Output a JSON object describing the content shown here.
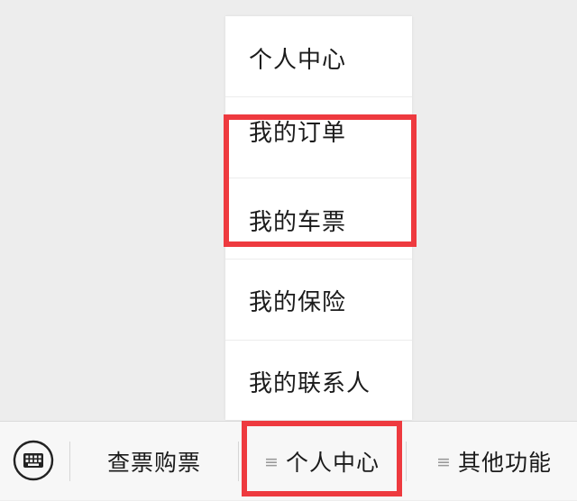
{
  "popup_menu": {
    "items": [
      {
        "label": "个人中心"
      },
      {
        "label": "我的订单"
      },
      {
        "label": "我的车票"
      },
      {
        "label": "我的保险"
      },
      {
        "label": "我的联系人"
      }
    ]
  },
  "menu_bar": {
    "keyboard_icon": "keyboard-icon",
    "tabs": [
      {
        "label": "查票购票",
        "has_menu_icon": false
      },
      {
        "label": "个人中心",
        "has_menu_icon": true,
        "icon_glyph": "≡"
      },
      {
        "label": "其他功能",
        "has_menu_icon": true,
        "icon_glyph": "≡"
      }
    ]
  },
  "colors": {
    "background": "#ededed",
    "menu_bar": "#f7f7f7",
    "popup": "#ffffff",
    "highlight": "#ee3a3f",
    "text": "#1b1b1b",
    "icon_gray": "#9a9a9a"
  }
}
